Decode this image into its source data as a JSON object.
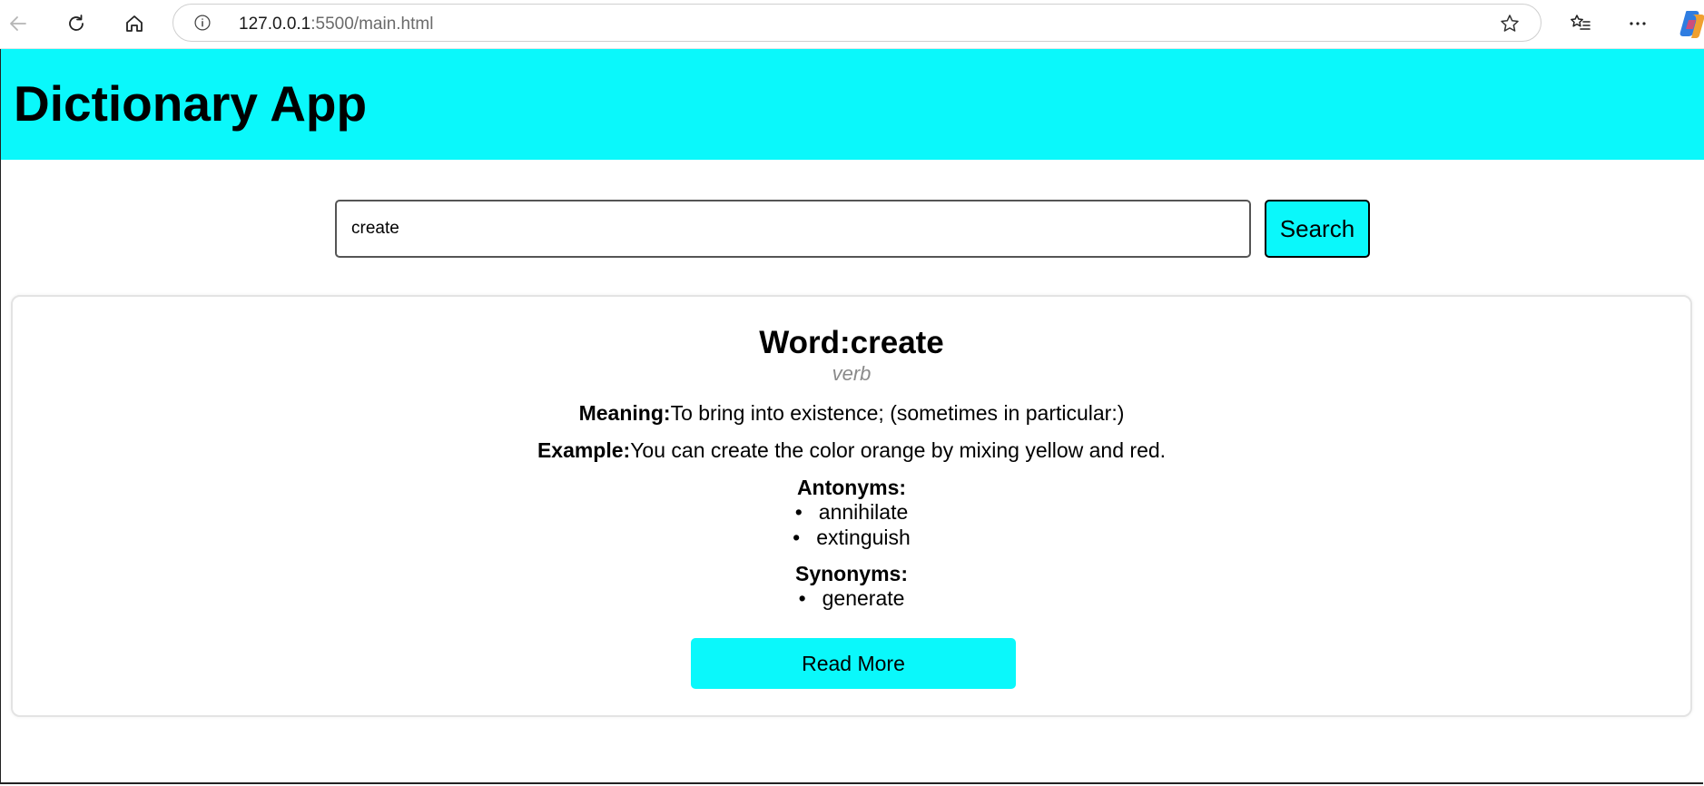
{
  "browser": {
    "url_host": "127.0.0.1",
    "url_port_path": ":5500/main.html",
    "icons": {
      "back": "back-arrow-icon",
      "reload": "reload-icon",
      "home": "home-icon",
      "info": "info-icon",
      "favorite": "star-icon",
      "favorites_list": "favorites-list-icon",
      "more": "more-icon",
      "copilot": "copilot-icon"
    }
  },
  "app": {
    "title": "Dictionary App",
    "accent_color": "#0af8fb"
  },
  "search": {
    "value": "create",
    "button_label": "Search"
  },
  "result": {
    "heading": "Word:create",
    "part_of_speech": "verb",
    "meaning_label": "Meaning:",
    "meaning_text": "To bring into existence; (sometimes in particular:)",
    "example_label": "Example:",
    "example_text": "You can create the color orange by mixing yellow and red.",
    "antonyms_label": "Antonyms:",
    "antonyms": [
      "annihilate",
      "extinguish"
    ],
    "synonyms_label": "Synonyms:",
    "synonyms": [
      "generate"
    ],
    "read_more_label": "Read More"
  }
}
